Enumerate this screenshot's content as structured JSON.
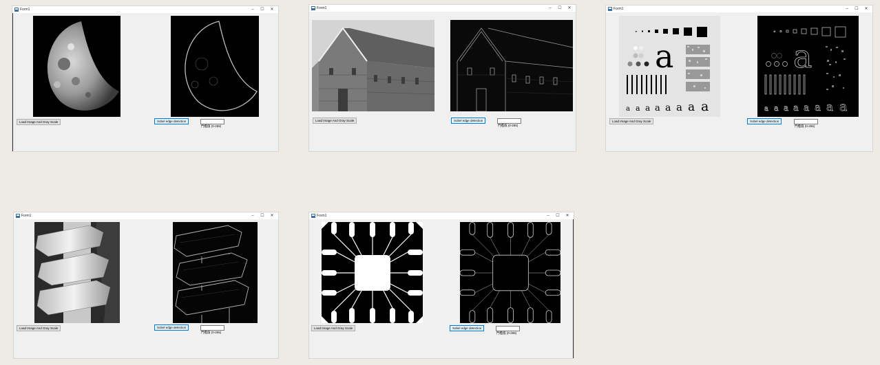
{
  "window": {
    "title": "Form1",
    "controls": {
      "minimize": "–",
      "maximize": "☐",
      "close": "✕"
    },
    "load_button": "Load Image And Gray Scale",
    "sobel_button": "Sobel edge detection",
    "threshold_label": "門檻值 (0-255)",
    "threshold_value": ""
  },
  "windows": [
    {
      "name": "form1-moon"
    },
    {
      "name": "form1-building"
    },
    {
      "name": "form1-test-pattern"
    },
    {
      "name": "form1-spring"
    },
    {
      "name": "form1-circuit"
    }
  ]
}
